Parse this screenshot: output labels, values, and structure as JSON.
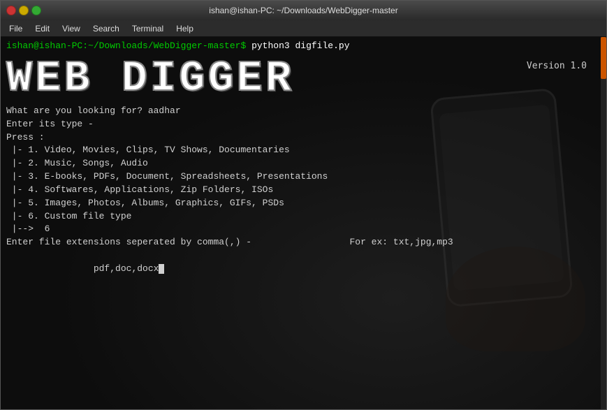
{
  "window": {
    "title": "ishan@ishan-PC: ~/Downloads/WebDigger-master",
    "buttons": {
      "close": "×",
      "minimize": "−",
      "maximize": "□"
    }
  },
  "menubar": {
    "items": [
      "File",
      "Edit",
      "View",
      "Search",
      "Terminal",
      "Help"
    ]
  },
  "terminal": {
    "prompt": "ishan@ishan-PC:~/Downloads/WebDigger-master$",
    "command": " python3 digfile.py",
    "app_title": "WEB DIGGER",
    "version": "Version 1.0",
    "lines": [
      "What are you looking for? aadhar",
      "",
      "Enter its type -",
      "Press :",
      " |- 1. Video, Movies, Clips, TV Shows, Documentaries",
      " |- 2. Music, Songs, Audio",
      " |- 3. E-books, PDFs, Document, Spreadsheets, Presentations",
      " |- 4. Softwares, Applications, Zip Folders, ISOs",
      " |- 5. Images, Photos, Albums, Graphics, GIFs, PSDs",
      " |- 6. Custom file type",
      " |-->  6",
      "",
      "Enter file extensions seperated by comma(,) -                  For ex: txt,jpg,mp3",
      "        pdf,doc,docx"
    ]
  }
}
